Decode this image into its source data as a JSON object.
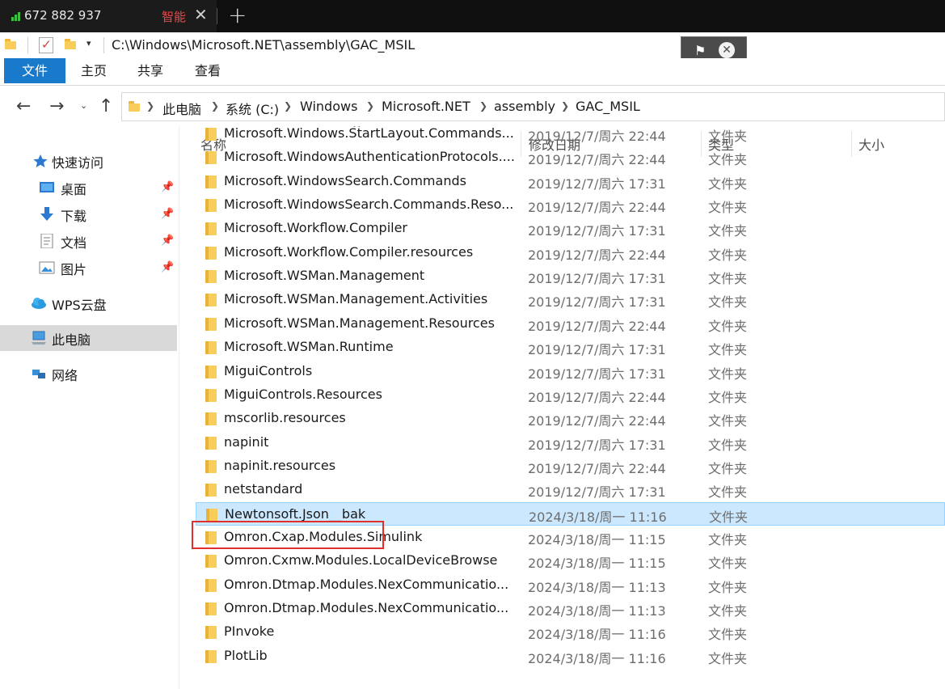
{
  "tabbar": {
    "tab_label": "672 882 937",
    "tab_mark": "智能",
    "close_glyph": "✕",
    "new_tab_glyph": "+"
  },
  "titlebar": {
    "path": "C:\\Windows\\Microsoft.NET\\assembly\\GAC_MSIL",
    "dropdown_glyph": "▾"
  },
  "overlay": {
    "flag_glyph": "⚑",
    "close_glyph": "✕"
  },
  "ribbon": {
    "tabs": [
      "文件",
      "主页",
      "共享",
      "查看"
    ]
  },
  "nav": {
    "back": "←",
    "forward": "→",
    "recent": "⌄",
    "up": "↑"
  },
  "breadcrumb": [
    "此电脑",
    "系统 (C:)",
    "Windows",
    "Microsoft.NET",
    "assembly",
    "GAC_MSIL"
  ],
  "sidebar": {
    "items": [
      {
        "label": "快速访问",
        "icon": "star-icon"
      },
      {
        "label": "桌面",
        "icon": "desktop-icon"
      },
      {
        "label": "下载",
        "icon": "download-icon"
      },
      {
        "label": "文档",
        "icon": "document-icon"
      },
      {
        "label": "图片",
        "icon": "pictures-icon"
      },
      {
        "label": "WPS云盘",
        "icon": "cloud-icon"
      },
      {
        "label": "此电脑",
        "icon": "computer-icon"
      },
      {
        "label": "网络",
        "icon": "network-icon"
      }
    ]
  },
  "columns": {
    "name": "名称",
    "date": "修改日期",
    "type": "类型",
    "size": "大小"
  },
  "files": [
    {
      "name": "Microsoft.Windows.StartLayout.Commands....",
      "date": "2019/12/7/周六 22:44",
      "type": "文件夹"
    },
    {
      "name": "Microsoft.WindowsAuthenticationProtocols....",
      "date": "2019/12/7/周六 22:44",
      "type": "文件夹"
    },
    {
      "name": "Microsoft.WindowsSearch.Commands",
      "date": "2019/12/7/周六 17:31",
      "type": "文件夹"
    },
    {
      "name": "Microsoft.WindowsSearch.Commands.Reso...",
      "date": "2019/12/7/周六 22:44",
      "type": "文件夹"
    },
    {
      "name": "Microsoft.Workflow.Compiler",
      "date": "2019/12/7/周六 17:31",
      "type": "文件夹"
    },
    {
      "name": "Microsoft.Workflow.Compiler.resources",
      "date": "2019/12/7/周六 22:44",
      "type": "文件夹"
    },
    {
      "name": "Microsoft.WSMan.Management",
      "date": "2019/12/7/周六 17:31",
      "type": "文件夹"
    },
    {
      "name": "Microsoft.WSMan.Management.Activities",
      "date": "2019/12/7/周六 17:31",
      "type": "文件夹"
    },
    {
      "name": "Microsoft.WSMan.Management.Resources",
      "date": "2019/12/7/周六 22:44",
      "type": "文件夹"
    },
    {
      "name": "Microsoft.WSMan.Runtime",
      "date": "2019/12/7/周六 17:31",
      "type": "文件夹"
    },
    {
      "name": "MiguiControls",
      "date": "2019/12/7/周六 17:31",
      "type": "文件夹"
    },
    {
      "name": "MiguiControls.Resources",
      "date": "2019/12/7/周六 22:44",
      "type": "文件夹"
    },
    {
      "name": "mscorlib.resources",
      "date": "2019/12/7/周六 22:44",
      "type": "文件夹"
    },
    {
      "name": "napinit",
      "date": "2019/12/7/周六 17:31",
      "type": "文件夹"
    },
    {
      "name": "napinit.resources",
      "date": "2019/12/7/周六 22:44",
      "type": "文件夹"
    },
    {
      "name": "netstandard",
      "date": "2019/12/7/周六 17:31",
      "type": "文件夹"
    },
    {
      "name": "Newtonsoft.Json__bak",
      "date": "2024/3/18/周一 11:16",
      "type": "文件夹"
    },
    {
      "name": "Omron.Cxap.Modules.Simulink",
      "date": "2024/3/18/周一 11:15",
      "type": "文件夹"
    },
    {
      "name": "Omron.Cxmw.Modules.LocalDeviceBrowse",
      "date": "2024/3/18/周一 11:15",
      "type": "文件夹"
    },
    {
      "name": "Omron.Dtmap.Modules.NexCommunicatio...",
      "date": "2024/3/18/周一 11:13",
      "type": "文件夹"
    },
    {
      "name": "Omron.Dtmap.Modules.NexCommunicatio...",
      "date": "2024/3/18/周一 11:13",
      "type": "文件夹"
    },
    {
      "name": "PInvoke",
      "date": "2024/3/18/周一 11:16",
      "type": "文件夹"
    },
    {
      "name": "PlotLib",
      "date": "2024/3/18/周一 11:16",
      "type": "文件夹"
    }
  ],
  "colors": {
    "accent": "#1979ca",
    "selection": "#cce8ff",
    "highlight": "#e0302c",
    "folder": "#f8cd5a"
  }
}
